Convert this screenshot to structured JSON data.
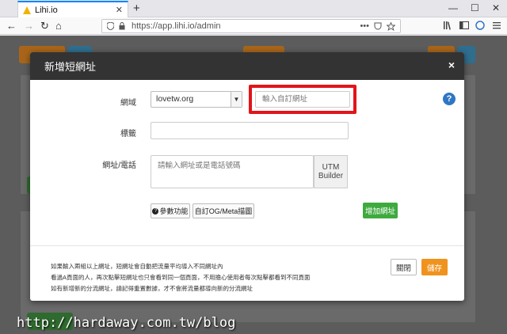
{
  "browser": {
    "tab_title": "Lihi.io",
    "tab_close": "✕",
    "new_tab": "+",
    "url": "https://app.lihi.io/admin",
    "nav_back": "←",
    "nav_forward": "→",
    "nav_reload": "↻",
    "nav_home": "⌂",
    "url_more": "•••",
    "win_minimize": "—",
    "win_maximize": "☐",
    "win_close": "✕"
  },
  "modal": {
    "title": "新增短網址",
    "close_label": "×",
    "domain_label": "網域",
    "domain_value": "lovetw.org",
    "custom_placeholder": "輸入自訂網址",
    "tag_label": "標籤",
    "url_label": "網址/電話",
    "url_placeholder": "請輸入網址或是電話號碼",
    "utm_label_line1": "UTM",
    "utm_label_line2": "Builder",
    "params_button": "參數功能",
    "og_button": "自訂OG/Meta描圖",
    "add_url_button": "增加網址",
    "notes": [
      "如果輸入兩組以上網址，短網址會自動把流量平均導入不同網址內",
      "看過A頁面的人，再次點擊短網址也只會看到同一個頁面，不用擔心使用者每次點擊都看到不同頁面",
      "如有新增新的分流網址，請記得重置數據，才不會將流量都導向新的分流網址"
    ],
    "close_button": "關閉",
    "save_button": "儲存"
  },
  "watermark": "http://hardaway.com.tw/blog",
  "colors": {
    "highlight_border": "#e2141b",
    "save": "#f0931e",
    "add": "#3eaa3e",
    "help": "#2f77c4",
    "overlay": "#5c5c5c"
  }
}
